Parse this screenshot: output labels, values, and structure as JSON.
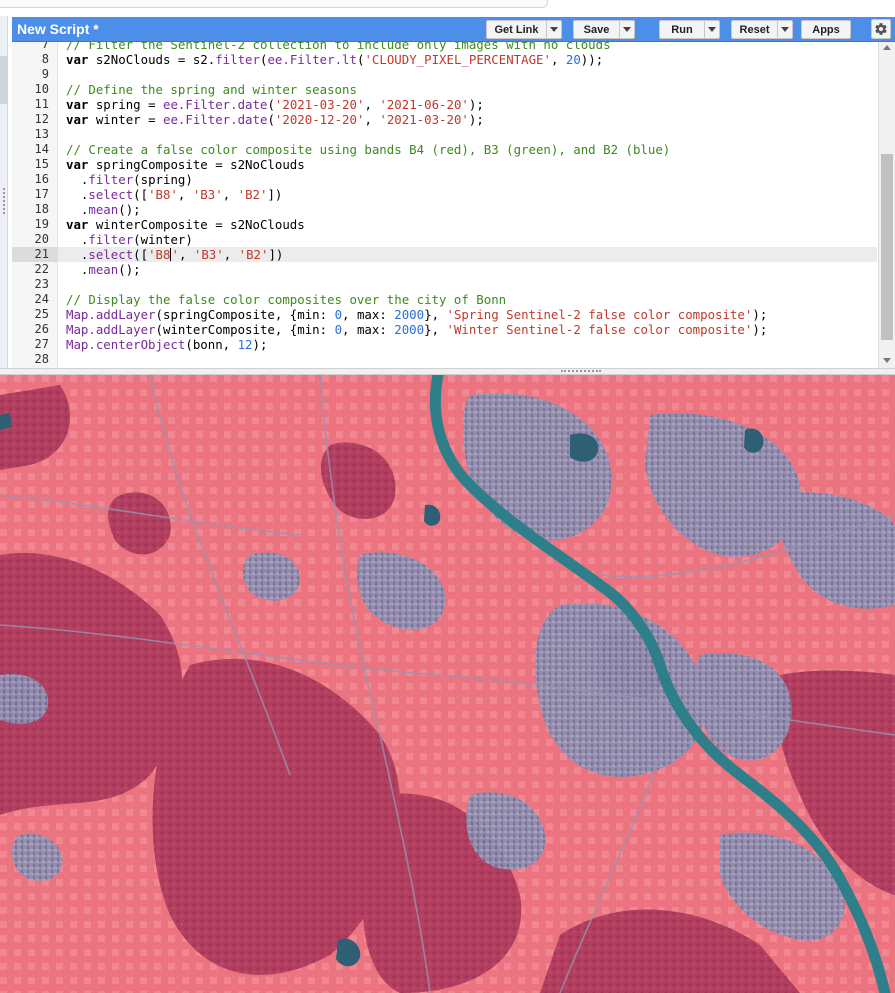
{
  "header": {
    "title": "New Script *",
    "buttons": {
      "get_link": "Get Link",
      "save": "Save",
      "run": "Run",
      "reset": "Reset",
      "apps": "Apps"
    },
    "settings_icon": "gear-icon"
  },
  "editor": {
    "active_line": 21,
    "lines": [
      {
        "n": "7",
        "tokens": [
          [
            "cm",
            "// Filter the Sentinel-2 collection to include only images with no clouds"
          ]
        ]
      },
      {
        "n": "8",
        "tokens": [
          [
            "kw",
            "var"
          ],
          [
            "tx",
            " s2NoClouds = s2."
          ],
          [
            "pr",
            "filter"
          ],
          [
            "tx",
            "("
          ],
          [
            "pr",
            "ee.Filter.lt"
          ],
          [
            "tx",
            "("
          ],
          [
            "st",
            "'CLOUDY_PIXEL_PERCENTAGE'"
          ],
          [
            "tx",
            ", "
          ],
          [
            "nu",
            "20"
          ],
          [
            "tx",
            "));"
          ]
        ]
      },
      {
        "n": "9",
        "tokens": []
      },
      {
        "n": "10",
        "tokens": [
          [
            "cm",
            "// Define the spring and winter seasons"
          ]
        ]
      },
      {
        "n": "11",
        "tokens": [
          [
            "kw",
            "var"
          ],
          [
            "tx",
            " spring = "
          ],
          [
            "pr",
            "ee.Filter.date"
          ],
          [
            "tx",
            "("
          ],
          [
            "st",
            "'2021-03-20'"
          ],
          [
            "tx",
            ", "
          ],
          [
            "st",
            "'2021-06-20'"
          ],
          [
            "tx",
            ");"
          ]
        ]
      },
      {
        "n": "12",
        "tokens": [
          [
            "kw",
            "var"
          ],
          [
            "tx",
            " winter = "
          ],
          [
            "pr",
            "ee.Filter.date"
          ],
          [
            "tx",
            "("
          ],
          [
            "st",
            "'2020-12-20'"
          ],
          [
            "tx",
            ", "
          ],
          [
            "st",
            "'2021-03-20'"
          ],
          [
            "tx",
            ");"
          ]
        ]
      },
      {
        "n": "13",
        "tokens": []
      },
      {
        "n": "14",
        "tokens": [
          [
            "cm",
            "// Create a false color composite using bands B4 (red), B3 (green), and B2 (blue)"
          ]
        ]
      },
      {
        "n": "15",
        "tokens": [
          [
            "kw",
            "var"
          ],
          [
            "tx",
            " springComposite = s2NoClouds"
          ]
        ]
      },
      {
        "n": "16",
        "tokens": [
          [
            "tx",
            "  ."
          ],
          [
            "pr",
            "filter"
          ],
          [
            "tx",
            "(spring)"
          ]
        ]
      },
      {
        "n": "17",
        "tokens": [
          [
            "tx",
            "  ."
          ],
          [
            "pr",
            "select"
          ],
          [
            "tx",
            "(["
          ],
          [
            "st",
            "'B8'"
          ],
          [
            "tx",
            ", "
          ],
          [
            "st",
            "'B3'"
          ],
          [
            "tx",
            ", "
          ],
          [
            "st",
            "'B2'"
          ],
          [
            "tx",
            "])"
          ]
        ]
      },
      {
        "n": "18",
        "tokens": [
          [
            "tx",
            "  ."
          ],
          [
            "pr",
            "mean"
          ],
          [
            "tx",
            "();"
          ]
        ]
      },
      {
        "n": "19",
        "tokens": [
          [
            "kw",
            "var"
          ],
          [
            "tx",
            " winterComposite = s2NoClouds"
          ]
        ]
      },
      {
        "n": "20",
        "tokens": [
          [
            "tx",
            "  ."
          ],
          [
            "pr",
            "filter"
          ],
          [
            "tx",
            "(winter)"
          ]
        ]
      },
      {
        "n": "21",
        "tokens": [
          [
            "tx",
            "  ."
          ],
          [
            "pr",
            "select"
          ],
          [
            "tx",
            "(["
          ],
          [
            "st",
            "'B8"
          ],
          [
            "cursor",
            ""
          ],
          [
            "st",
            "'"
          ],
          [
            "tx",
            ", "
          ],
          [
            "st",
            "'B3'"
          ],
          [
            "tx",
            ", "
          ],
          [
            "st",
            "'B2'"
          ],
          [
            "tx",
            "])"
          ]
        ]
      },
      {
        "n": "22",
        "tokens": [
          [
            "tx",
            "  ."
          ],
          [
            "pr",
            "mean"
          ],
          [
            "tx",
            "();"
          ]
        ]
      },
      {
        "n": "23",
        "tokens": []
      },
      {
        "n": "24",
        "tokens": [
          [
            "cm",
            "// Display the false color composites over the city of Bonn"
          ]
        ]
      },
      {
        "n": "25",
        "tokens": [
          [
            "pr",
            "Map.addLayer"
          ],
          [
            "tx",
            "(springComposite, {min: "
          ],
          [
            "nu",
            "0"
          ],
          [
            "tx",
            ", max: "
          ],
          [
            "nu",
            "2000"
          ],
          [
            "tx",
            "}, "
          ],
          [
            "st",
            "'Spring Sentinel-2 false color composite'"
          ],
          [
            "tx",
            ");"
          ]
        ]
      },
      {
        "n": "26",
        "tokens": [
          [
            "pr",
            "Map.addLayer"
          ],
          [
            "tx",
            "(winterComposite, {min: "
          ],
          [
            "nu",
            "0"
          ],
          [
            "tx",
            ", max: "
          ],
          [
            "nu",
            "2000"
          ],
          [
            "tx",
            "}, "
          ],
          [
            "st",
            "'Winter Sentinel-2 false color composite'"
          ],
          [
            "tx",
            ");"
          ]
        ]
      },
      {
        "n": "27",
        "tokens": [
          [
            "pr",
            "Map.centerObject"
          ],
          [
            "tx",
            "(bonn, "
          ],
          [
            "nu",
            "12"
          ],
          [
            "tx",
            ");"
          ]
        ]
      },
      {
        "n": "28",
        "tokens": []
      }
    ]
  },
  "colors": {
    "header_blue": "#4c8ee8",
    "comment": "#3d8a1f",
    "string": "#c0392b",
    "number": "#2b6fd6",
    "property": "#7a2a9b",
    "map_vegetation": "#e9707c",
    "map_forest": "#b33d5e",
    "map_urban": "#8a8fb0",
    "map_river": "#2f7f8a"
  }
}
